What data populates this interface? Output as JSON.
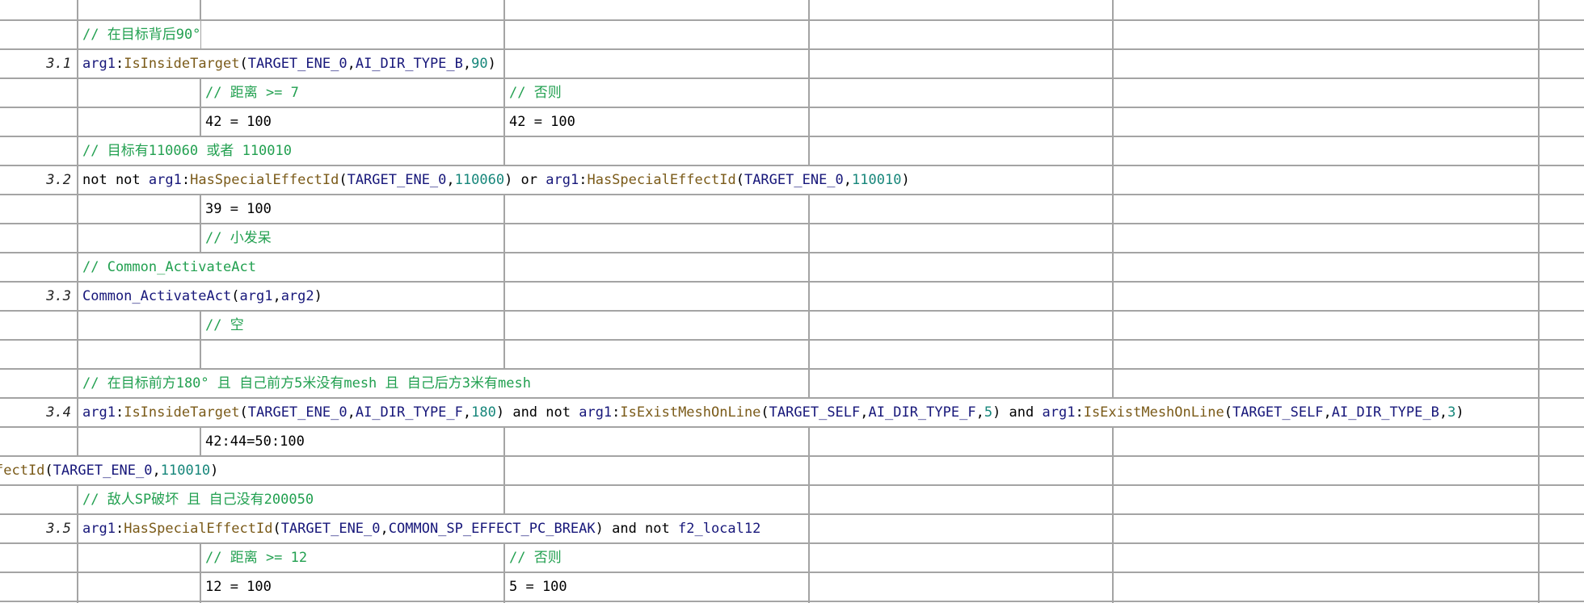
{
  "sheet": {
    "rows": [
      {
        "id": "r0",
        "cells": []
      },
      {
        "id": "r1",
        "cells": [
          {
            "col": "b",
            "tokens": [
              {
                "t": "// 在目标背后90°",
                "c": "cm"
              }
            ]
          }
        ]
      },
      {
        "id": "r2",
        "num": "3.1",
        "cells": [
          {
            "col": "b",
            "tokens": [
              {
                "t": "arg1",
                "c": "v"
              },
              {
                "t": ":",
                "c": "k"
              },
              {
                "t": "IsInsideTarget",
                "c": "f"
              },
              {
                "t": "(",
                "c": "k"
              },
              {
                "t": "TARGET_ENE_0",
                "c": "v"
              },
              {
                "t": ",",
                "c": "k"
              },
              {
                "t": "AI_DIR_TYPE_B",
                "c": "v"
              },
              {
                "t": ",",
                "c": "k"
              },
              {
                "t": "90",
                "c": "n"
              },
              {
                "t": ")",
                "c": "k"
              }
            ]
          }
        ]
      },
      {
        "id": "r3",
        "cells": [
          {
            "col": "c",
            "tokens": [
              {
                "t": "// 距离 >= 7",
                "c": "cm"
              }
            ]
          },
          {
            "col": "d",
            "tokens": [
              {
                "t": "// 否则",
                "c": "cm"
              }
            ]
          }
        ]
      },
      {
        "id": "r4",
        "cells": [
          {
            "col": "c",
            "tokens": [
              {
                "t": "42 = 100",
                "c": "k"
              }
            ]
          },
          {
            "col": "d",
            "tokens": [
              {
                "t": "42 = 100",
                "c": "k"
              }
            ]
          }
        ]
      },
      {
        "id": "r5",
        "cells": [
          {
            "col": "b",
            "tokens": [
              {
                "t": "// 目标有110060 或者 110010",
                "c": "cm"
              }
            ]
          }
        ]
      },
      {
        "id": "r6",
        "num": "3.2",
        "cells": [
          {
            "col": "b",
            "tokens": [
              {
                "t": "not not ",
                "c": "k"
              },
              {
                "t": "arg1",
                "c": "v"
              },
              {
                "t": ":",
                "c": "k"
              },
              {
                "t": "HasSpecialEffectId",
                "c": "f"
              },
              {
                "t": "(",
                "c": "k"
              },
              {
                "t": "TARGET_ENE_0",
                "c": "v"
              },
              {
                "t": ",",
                "c": "k"
              },
              {
                "t": "110060",
                "c": "n"
              },
              {
                "t": ") or ",
                "c": "k"
              },
              {
                "t": "arg1",
                "c": "v"
              },
              {
                "t": ":",
                "c": "k"
              },
              {
                "t": "HasSpecialEffectId",
                "c": "f"
              },
              {
                "t": "(",
                "c": "k"
              },
              {
                "t": "TARGET_ENE_0",
                "c": "v"
              },
              {
                "t": ",",
                "c": "k"
              },
              {
                "t": "110010",
                "c": "n"
              },
              {
                "t": ")",
                "c": "k"
              }
            ]
          }
        ]
      },
      {
        "id": "r7",
        "cells": [
          {
            "col": "c",
            "tokens": [
              {
                "t": "39 = 100",
                "c": "k"
              }
            ]
          }
        ]
      },
      {
        "id": "r8",
        "cells": [
          {
            "col": "c",
            "tokens": [
              {
                "t": "// 小发呆",
                "c": "cm"
              }
            ]
          }
        ]
      },
      {
        "id": "r9",
        "cells": [
          {
            "col": "b",
            "tokens": [
              {
                "t": "// Common_ActivateAct",
                "c": "cm"
              }
            ]
          }
        ]
      },
      {
        "id": "r10",
        "num": "3.3",
        "cells": [
          {
            "col": "b",
            "tokens": [
              {
                "t": "Common_ActivateAct",
                "c": "v"
              },
              {
                "t": "(",
                "c": "k"
              },
              {
                "t": "arg1",
                "c": "v"
              },
              {
                "t": ",",
                "c": "k"
              },
              {
                "t": "arg2",
                "c": "v"
              },
              {
                "t": ")",
                "c": "k"
              }
            ]
          }
        ]
      },
      {
        "id": "r11",
        "cells": [
          {
            "col": "c",
            "tokens": [
              {
                "t": "// 空",
                "c": "cm"
              }
            ]
          }
        ]
      },
      {
        "id": "r12",
        "cells": []
      },
      {
        "id": "r13",
        "cells": [
          {
            "col": "b",
            "tokens": [
              {
                "t": "// 在目标前方180° 且 自己前方5米没有mesh 且 自己后方3米有mesh",
                "c": "cm"
              }
            ]
          }
        ]
      },
      {
        "id": "r14",
        "num": "3.4",
        "cells": [
          {
            "col": "b",
            "tokens": [
              {
                "t": "arg1",
                "c": "v"
              },
              {
                "t": ":",
                "c": "k"
              },
              {
                "t": "IsInsideTarget",
                "c": "f"
              },
              {
                "t": "(",
                "c": "k"
              },
              {
                "t": "TARGET_ENE_0",
                "c": "v"
              },
              {
                "t": ",",
                "c": "k"
              },
              {
                "t": "AI_DIR_TYPE_F",
                "c": "v"
              },
              {
                "t": ",",
                "c": "k"
              },
              {
                "t": "180",
                "c": "n"
              },
              {
                "t": ") and not ",
                "c": "k"
              },
              {
                "t": "arg1",
                "c": "v"
              },
              {
                "t": ":",
                "c": "k"
              },
              {
                "t": "IsExistMeshOnLine",
                "c": "f"
              },
              {
                "t": "(",
                "c": "k"
              },
              {
                "t": "TARGET_SELF",
                "c": "v"
              },
              {
                "t": ",",
                "c": "k"
              },
              {
                "t": "AI_DIR_TYPE_F",
                "c": "v"
              },
              {
                "t": ",",
                "c": "k"
              },
              {
                "t": "5",
                "c": "n"
              },
              {
                "t": ") and ",
                "c": "k"
              },
              {
                "t": "arg1",
                "c": "v"
              },
              {
                "t": ":",
                "c": "k"
              },
              {
                "t": "IsExistMeshOnLine",
                "c": "f"
              },
              {
                "t": "(",
                "c": "k"
              },
              {
                "t": "TARGET_SELF",
                "c": "v"
              },
              {
                "t": ",",
                "c": "k"
              },
              {
                "t": "AI_DIR_TYPE_B",
                "c": "v"
              },
              {
                "t": ",",
                "c": "k"
              },
              {
                "t": "3",
                "c": "n"
              },
              {
                "t": ")",
                "c": "k"
              }
            ]
          }
        ]
      },
      {
        "id": "r15",
        "cells": [
          {
            "col": "c",
            "tokens": [
              {
                "t": "42:44=50:100",
                "c": "k"
              }
            ]
          }
        ]
      },
      {
        "id": "r16",
        "cells": [
          {
            "col": "a",
            "tokens": [
              {
                "t": "fectId",
                "c": "f"
              },
              {
                "t": "(",
                "c": "k"
              },
              {
                "t": "TARGET_ENE_0",
                "c": "v"
              },
              {
                "t": ",",
                "c": "k"
              },
              {
                "t": "110010",
                "c": "n"
              },
              {
                "t": ")",
                "c": "k"
              }
            ]
          }
        ]
      },
      {
        "id": "r17",
        "cells": [
          {
            "col": "b",
            "tokens": [
              {
                "t": "// 敌人SP破坏 且 自己没有200050",
                "c": "cm"
              }
            ]
          }
        ]
      },
      {
        "id": "r18",
        "num": "3.5",
        "cells": [
          {
            "col": "b",
            "tokens": [
              {
                "t": "arg1",
                "c": "v"
              },
              {
                "t": ":",
                "c": "k"
              },
              {
                "t": "HasSpecialEffectId",
                "c": "f"
              },
              {
                "t": "(",
                "c": "k"
              },
              {
                "t": "TARGET_ENE_0",
                "c": "v"
              },
              {
                "t": ",",
                "c": "k"
              },
              {
                "t": "COMMON_SP_EFFECT_PC_BREAK",
                "c": "v"
              },
              {
                "t": ") and not ",
                "c": "k"
              },
              {
                "t": "f2_local12",
                "c": "v"
              }
            ]
          }
        ]
      },
      {
        "id": "r19",
        "cells": [
          {
            "col": "c",
            "tokens": [
              {
                "t": "// 距离 >= 12",
                "c": "cm"
              }
            ]
          },
          {
            "col": "d",
            "tokens": [
              {
                "t": "// 否则",
                "c": "cm"
              }
            ]
          }
        ]
      },
      {
        "id": "r20",
        "cells": [
          {
            "col": "c",
            "tokens": [
              {
                "t": "12 = 100",
                "c": "k"
              }
            ]
          },
          {
            "col": "d",
            "tokens": [
              {
                "t": "5 = 100",
                "c": "k"
              }
            ]
          }
        ]
      }
    ]
  }
}
